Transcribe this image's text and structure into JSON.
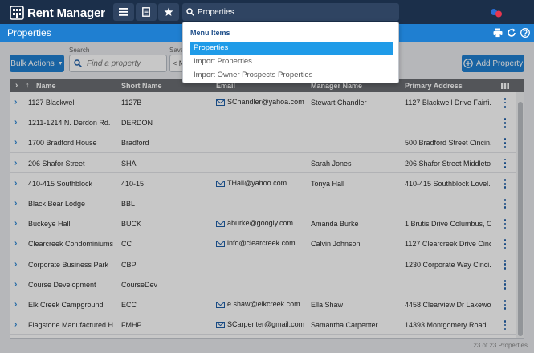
{
  "app": {
    "name": "Rent Manager"
  },
  "nav": {
    "search_value": "Properties",
    "buttons": [
      "menu",
      "document",
      "favorites"
    ]
  },
  "titlebar": {
    "title": "Properties"
  },
  "toolbar": {
    "bulk_actions_label": "Bulk Actions",
    "search_label": "Search",
    "search_placeholder": "Find a property",
    "saved_label": "Save",
    "saved_value": "< N",
    "add_label": "Add Property"
  },
  "grid": {
    "columns": [
      "Name",
      "Short Name",
      "Email",
      "Manager Name",
      "Primary Address"
    ],
    "rows": [
      {
        "name": "1127 Blackwell",
        "short": "1127B",
        "email": "SChandler@yahoa.com",
        "manager": "Stewart Chandler",
        "address": "1127 Blackwell Drive Fairfi..."
      },
      {
        "name": "1211-1214 N. Derdon Rd.",
        "short": "DERDON",
        "email": "",
        "manager": "",
        "address": ""
      },
      {
        "name": "1700 Bradford House",
        "short": "Bradford",
        "email": "",
        "manager": "",
        "address": "500 Bradford Street Cincin..."
      },
      {
        "name": "206 Shafor Street",
        "short": "SHA",
        "email": "",
        "manager": "Sarah Jones",
        "address": "206 Shafor Street Middleto..."
      },
      {
        "name": "410-415 Southblock",
        "short": "410-15",
        "email": "THall@yahoo.com",
        "manager": "Tonya Hall",
        "address": "410-415 Southblock Lovel..."
      },
      {
        "name": "Black Bear Lodge",
        "short": "BBL",
        "email": "",
        "manager": "",
        "address": ""
      },
      {
        "name": "Buckeye Hall",
        "short": "BUCK",
        "email": "aburke@googly.com",
        "manager": "Amanda Burke",
        "address": "1 Brutis Drive Columbus, O..."
      },
      {
        "name": "Clearcreek Condominiums",
        "short": "CC",
        "email": "info@clearcreek.com",
        "manager": "Calvin Johnson",
        "address": "1127 Clearcreek Drive Cinc..."
      },
      {
        "name": "Corporate Business Park",
        "short": "CBP",
        "email": "",
        "manager": "",
        "address": "1230 Corporate Way Cinci..."
      },
      {
        "name": "Course Development",
        "short": "CourseDev",
        "email": "",
        "manager": "",
        "address": ""
      },
      {
        "name": "Elk Creek Campground",
        "short": "ECC",
        "email": "e.shaw@elkcreek.com",
        "manager": "Ella Shaw",
        "address": "4458 Clearview Dr Lakewo..."
      },
      {
        "name": "Flagstone Manufactured H...",
        "short": "FMHP",
        "email": "SCarpenter@gmail.com",
        "manager": "Samantha Carpenter",
        "address": "14393 Montgomery Road ..."
      }
    ],
    "footer_count": "23 of 23 Properties"
  },
  "dropdown": {
    "header": "Menu Items",
    "items": [
      "Properties",
      "Import Properties",
      "Import Owner Prospects Properties"
    ],
    "active_index": 0
  },
  "colors": {
    "nav_bg": "#1b2f4a",
    "accent": "#1f7fd1",
    "highlight": "#1f9be8",
    "brand_red": "#e8364f",
    "brand_blue": "#2a6fd6"
  }
}
